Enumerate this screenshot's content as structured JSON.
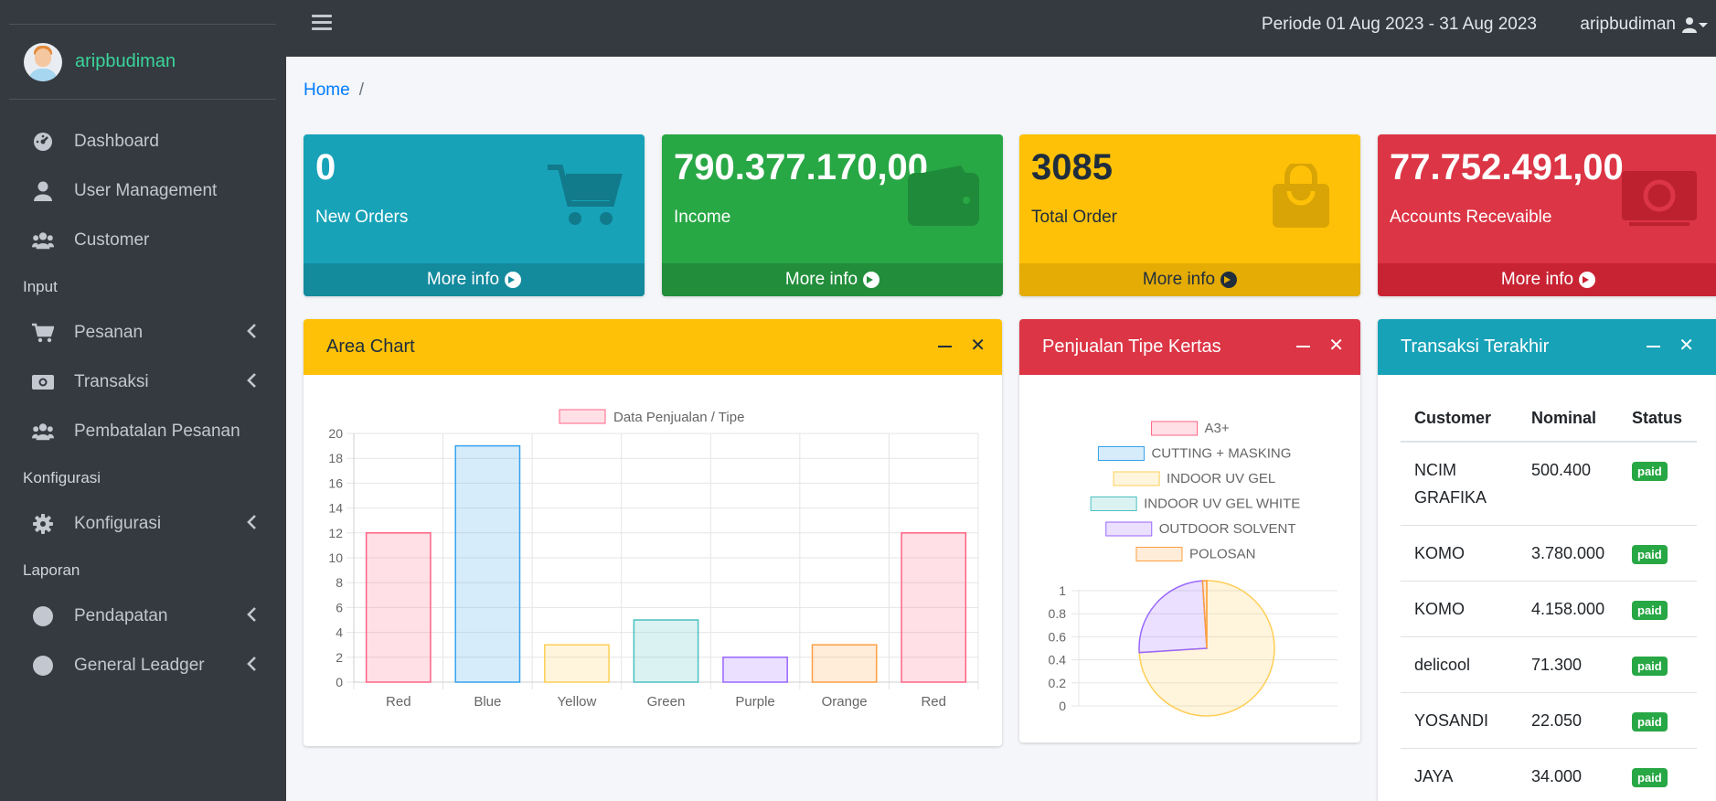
{
  "user": {
    "name": "aripbudiman"
  },
  "sidebar": {
    "items": [
      {
        "type": "item",
        "label": "Dashboard",
        "icon": "dashboard-icon",
        "chevron": false
      },
      {
        "type": "item",
        "label": "User Management",
        "icon": "user-icon",
        "chevron": false
      },
      {
        "type": "item",
        "label": "Customer",
        "icon": "users-icon",
        "chevron": false
      },
      {
        "type": "header",
        "label": "Input"
      },
      {
        "type": "item",
        "label": "Pesanan",
        "icon": "cart-icon",
        "chevron": true
      },
      {
        "type": "item",
        "label": "Transaksi",
        "icon": "money-icon",
        "chevron": true
      },
      {
        "type": "item",
        "label": "Pembatalan Pesanan",
        "icon": "users-icon",
        "chevron": false
      },
      {
        "type": "header",
        "label": "Konfigurasi"
      },
      {
        "type": "item",
        "label": "Konfigurasi",
        "icon": "gear-icon",
        "chevron": true
      },
      {
        "type": "header",
        "label": "Laporan"
      },
      {
        "type": "item",
        "label": "Pendapatan",
        "icon": "circle-icon",
        "chevron": true
      },
      {
        "type": "item",
        "label": "General Leadger",
        "icon": "circle-icon",
        "chevron": true
      }
    ]
  },
  "topbar": {
    "period": "Periode 01 Aug 2023 - 31 Aug 2023",
    "username": "aripbudiman"
  },
  "breadcrumb": {
    "home": "Home",
    "separator": "/"
  },
  "boxes": [
    {
      "value": "0",
      "label": "New Orders",
      "more": "More info",
      "icon": "cart-icon",
      "color": "#17a2b8"
    },
    {
      "value": "790.377.170,00",
      "label": "Income",
      "more": "More info",
      "icon": "wallet-icon",
      "color": "#28a745"
    },
    {
      "value": "3085",
      "label": "Total Order",
      "more": "More info",
      "icon": "bag-icon",
      "color": "#ffc107"
    },
    {
      "value": "77.752.491,00",
      "label": "Accounts Recevaible",
      "more": "More info",
      "icon": "money-icon",
      "color": "#dc3545"
    }
  ],
  "area_card": {
    "title": "Area Chart"
  },
  "pie_card": {
    "title": "Penjualan Tipe Kertas"
  },
  "tx_card": {
    "title": "Transaksi Terakhir",
    "columns": [
      "Customer",
      "Nominal",
      "Status"
    ],
    "rows": [
      {
        "customer": "NCIM GRAFIKA",
        "nominal": "500.400",
        "status": "paid"
      },
      {
        "customer": "KOMO",
        "nominal": "3.780.000",
        "status": "paid"
      },
      {
        "customer": "KOMO",
        "nominal": "4.158.000",
        "status": "paid"
      },
      {
        "customer": "delicool",
        "nominal": "71.300",
        "status": "paid"
      },
      {
        "customer": "YOSANDI",
        "nominal": "22.050",
        "status": "paid"
      },
      {
        "customer": "JAYA",
        "nominal": "34.000",
        "status": "paid"
      }
    ]
  },
  "chart_data": [
    {
      "type": "bar",
      "categories": [
        "Red",
        "Blue",
        "Yellow",
        "Green",
        "Purple",
        "Orange",
        "Red"
      ],
      "series": [
        {
          "name": "Data Penjualan / Tipe",
          "values": [
            12,
            19,
            3,
            5,
            2,
            3,
            12
          ]
        }
      ],
      "colors": [
        "#ff6384",
        "#36a2eb",
        "#ffce56",
        "#4bc0c0",
        "#9966ff",
        "#ff9f40",
        "#ff6384"
      ],
      "ylim": [
        0,
        20
      ],
      "yticks": [
        0,
        2,
        4,
        6,
        8,
        10,
        12,
        14,
        16,
        18,
        20
      ],
      "legend": "top",
      "grid": true
    },
    {
      "type": "pie",
      "labels": [
        "A3+",
        "CUTTING + MASKING",
        "INDOOR UV GEL",
        "INDOOR UV GEL WHITE",
        "OUTDOOR SOLVENT",
        "POLOSAN"
      ],
      "colors": [
        "#ff6384",
        "#36a2eb",
        "#ffce56",
        "#4bc0c0",
        "#9966ff",
        "#ff9f40"
      ],
      "values": [
        0,
        0,
        0.74,
        0,
        0.25,
        0.01
      ],
      "yticks": [
        0,
        0.2,
        0.4,
        0.6,
        0.8,
        1
      ],
      "legend": "top",
      "grid": true
    }
  ]
}
